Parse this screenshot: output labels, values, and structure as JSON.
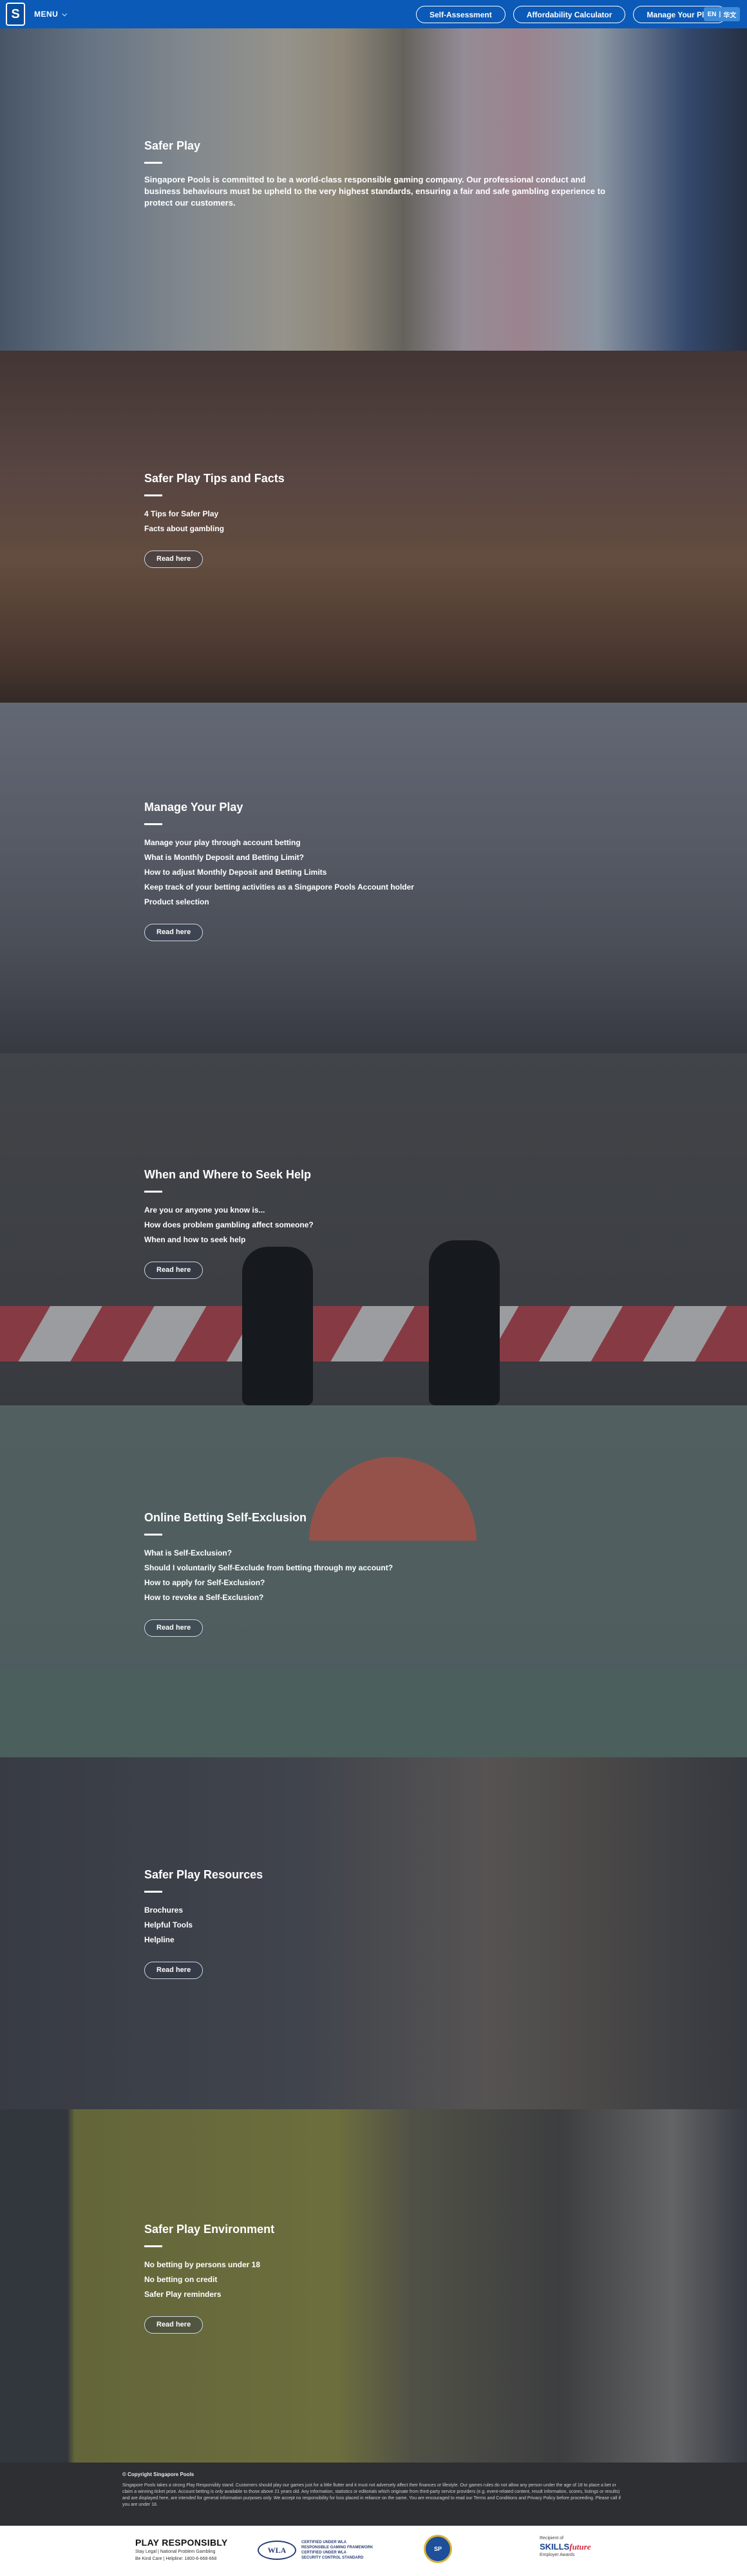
{
  "header": {
    "logo_text": "S",
    "menu_label": "MENU",
    "buttons": [
      {
        "label": "Self-Assessment"
      },
      {
        "label": "Affordability Calculator"
      },
      {
        "label": "Manage Your Play"
      }
    ],
    "language": {
      "en": "EN",
      "zh": "华文"
    }
  },
  "sections": [
    {
      "title": "Safer Play",
      "description": "Singapore Pools is committed to be a world-class responsible gaming company. Our professional conduct and business behaviours must be upheld to the very highest standards, ensuring a fair and safe gambling experience to protect our customers.",
      "links": [],
      "button": ""
    },
    {
      "title": "Safer Play Tips and Facts",
      "links": [
        "4 Tips for Safer Play",
        "Facts about gambling"
      ],
      "button": "Read here"
    },
    {
      "title": "Manage Your Play",
      "links": [
        "Manage your play through account betting",
        "What is Monthly Deposit and Betting Limit?",
        "How to adjust Monthly Deposit and Betting Limits",
        "Keep track of your betting activities as a Singapore Pools Account holder",
        "Product selection"
      ],
      "button": "Read here"
    },
    {
      "title": "When and Where to Seek Help",
      "links": [
        "Are you or anyone you know is...",
        "How does problem gambling affect someone?",
        "When and how to seek help"
      ],
      "button": "Read here"
    },
    {
      "title": "Online Betting Self-Exclusion",
      "links": [
        "What is Self-Exclusion?",
        "Should I voluntarily Self-Exclude from betting through my account?",
        "How to apply for Self-Exclusion?",
        "How to revoke a Self-Exclusion?"
      ],
      "button": "Read here"
    },
    {
      "title": "Safer Play Resources",
      "links": [
        "Brochures",
        "Helpful Tools",
        "Helpline"
      ],
      "button": "Read here"
    },
    {
      "title": "Safer Play Environment",
      "links": [
        "No betting by persons under 18",
        "No betting on credit",
        "Safer Play reminders"
      ],
      "button": "Read here"
    }
  ],
  "footer": {
    "copyright": "© Copyright Singapore Pools",
    "disclaimer": "Singapore Pools takes a strong Play Responsibly stand. Customers should play our games just for a little flutter and it must not adversely affect their finances or lifestyle. Our games rules do not allow any person under the age of 18 to place a bet or claim a winning ticket prize. Account betting is only available to those above 21 years old. Any information, statistics or editorials which originate from third-party service providers (e.g. event-related content, result information, scores, listings or results) and are displayed here, are intended for general information purposes only. We accept no responsibility for loss placed in reliance on the same. You are encouraged to read our Terms and Conditions and Privacy Policy before proceeding. Please call if you are under 18.",
    "play_responsibly": {
      "title": "PLAY RESPONSIBLY",
      "lines": [
        "Stay Legal  |  National Problem Gambling",
        "Be Kind Care  |  Helpline: 1800-6-668-668"
      ]
    },
    "wla": {
      "mark": "WLA",
      "lines": [
        "CERTIFIED UNDER WLA",
        "RESPONSIBLE GAMING FRAMEWORK",
        "CERTIFIED UNDER WLA",
        "SECURITY CONTROL STANDARD"
      ]
    },
    "seal": "SP",
    "skills": {
      "small": "Recipient of",
      "logo_a": "SKILLS",
      "logo_b": "future",
      "sub": "Employer Awards"
    }
  }
}
